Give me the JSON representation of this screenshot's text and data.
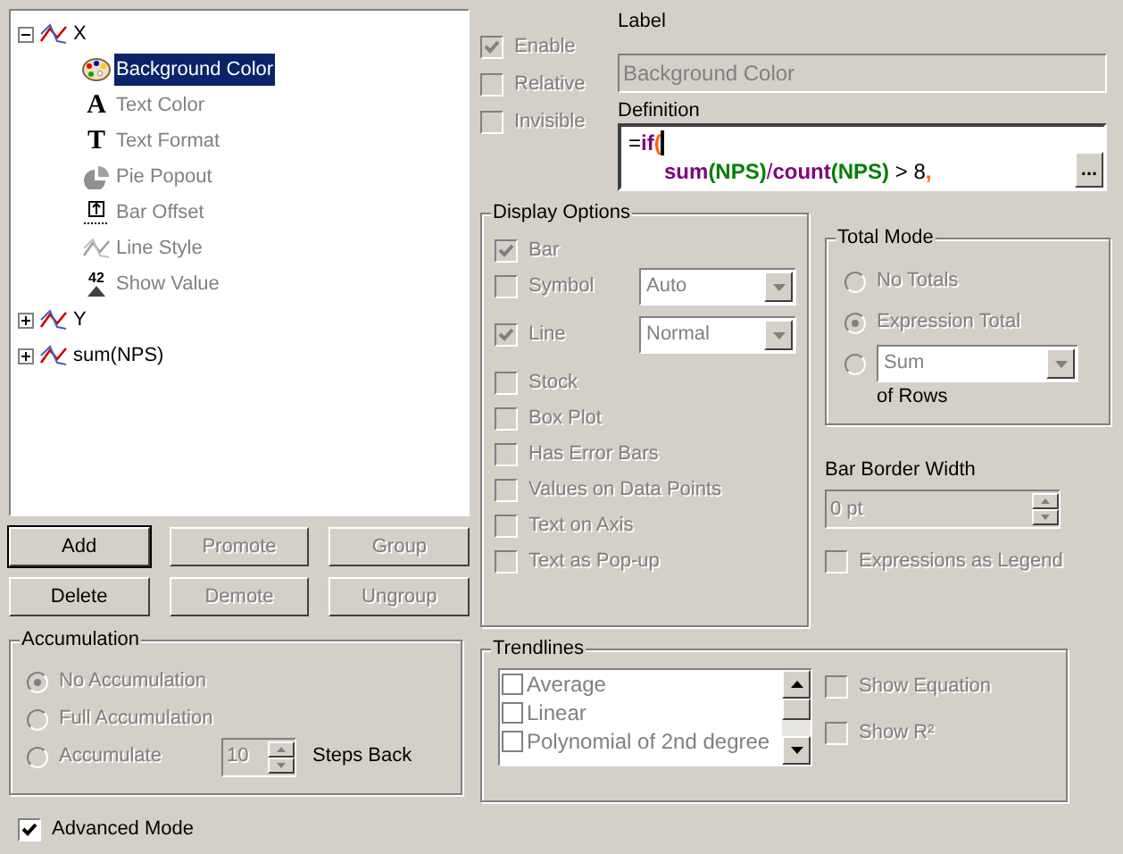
{
  "tree": {
    "items": [
      {
        "label": "X",
        "expanded": true,
        "children": [
          {
            "label": "Background Color",
            "kind": "palette",
            "defined": true,
            "selected": true
          },
          {
            "label": "Text Color",
            "kind": "glyph",
            "glyph": "A",
            "defined": false,
            "selected": false
          },
          {
            "label": "Text Format",
            "kind": "glyph",
            "glyph": "T",
            "defined": false,
            "selected": false
          },
          {
            "label": "Pie Popout",
            "kind": "pie",
            "defined": false,
            "selected": false
          },
          {
            "label": "Bar Offset",
            "kind": "offset",
            "defined": false,
            "selected": false
          },
          {
            "label": "Line Style",
            "kind": "line",
            "defined": false,
            "selected": false
          },
          {
            "label": "Show Value",
            "kind": "value",
            "glyph": "42",
            "defined": false,
            "selected": false
          }
        ]
      },
      {
        "label": "Y",
        "expanded": false
      },
      {
        "label": "sum(NPS)",
        "expanded": false
      }
    ]
  },
  "buttons": [
    {
      "label": "Add",
      "disabled": false,
      "default": true
    },
    {
      "label": "Promote",
      "disabled": true,
      "default": false
    },
    {
      "label": "Group",
      "disabled": true,
      "default": false
    },
    {
      "label": "Delete",
      "disabled": false,
      "default": false
    },
    {
      "label": "Demote",
      "disabled": true,
      "default": false
    },
    {
      "label": "Ungroup",
      "disabled": true,
      "default": false
    }
  ],
  "accumulation": {
    "title": "Accumulation",
    "disabled": true,
    "options": [
      {
        "label": "No Accumulation",
        "selected": true
      },
      {
        "label": "Full Accumulation",
        "selected": false
      },
      {
        "label": "Accumulate",
        "selected": false
      }
    ],
    "steps": "10",
    "steps_label": "Steps Back"
  },
  "advanced_mode": {
    "label": "Advanced Mode",
    "checked": true
  },
  "flags": [
    {
      "label": "Enable",
      "checked": true,
      "disabled": true
    },
    {
      "label": "Relative",
      "checked": false,
      "disabled": true
    },
    {
      "label": "Invisible",
      "checked": false,
      "disabled": true
    }
  ],
  "label_field": {
    "caption": "Label",
    "value": "Background Color",
    "disabled": true
  },
  "definition": {
    "caption": "Definition",
    "button": "...",
    "lines": [
      [
        {
          "kind": "plain",
          "text": "="
        },
        {
          "kind": "function",
          "text": "if"
        },
        {
          "kind": "delimiter",
          "text": "("
        }
      ],
      [
        {
          "kind": "function",
          "text": "sum"
        },
        {
          "kind": "field",
          "text": "(NPS)"
        },
        {
          "kind": "operator",
          "text": "/"
        },
        {
          "kind": "function",
          "text": "count"
        },
        {
          "kind": "field",
          "text": "(NPS)"
        },
        {
          "kind": "plain",
          "text": " > 8"
        },
        {
          "kind": "delimiter",
          "text": ","
        }
      ]
    ]
  },
  "display_options": {
    "title": "Display Options",
    "disabled": true,
    "options": [
      {
        "label": "Bar",
        "checked": true
      },
      {
        "label": "Symbol",
        "checked": false,
        "combo": "Auto"
      },
      {
        "label": "Line",
        "checked": true,
        "combo": "Normal"
      },
      {
        "label": "Stock",
        "checked": false
      },
      {
        "label": "Box Plot",
        "checked": false
      },
      {
        "label": "Has Error Bars",
        "checked": false
      },
      {
        "label": "Values on Data Points",
        "checked": false
      },
      {
        "label": "Text on Axis",
        "checked": false
      },
      {
        "label": "Text as Pop-up",
        "checked": false
      }
    ]
  },
  "total_mode": {
    "title": "Total Mode",
    "disabled": true,
    "options": [
      {
        "label": "No Totals",
        "selected": false
      },
      {
        "label": "Expression Total",
        "selected": true
      },
      {
        "combo": "Sum",
        "selected": false
      }
    ],
    "suffix": "of Rows"
  },
  "bar_border_width": {
    "caption": "Bar Border Width",
    "value": "0 pt",
    "disabled": true
  },
  "expressions_as_legend": {
    "label": "Expressions as Legend",
    "checked": false,
    "disabled": true
  },
  "trendlines": {
    "title": "Trendlines",
    "disabled": true,
    "items": [
      {
        "label": "Average",
        "checked": false
      },
      {
        "label": "Linear",
        "checked": false
      },
      {
        "label": "Polynomial of 2nd degree",
        "checked": false
      }
    ],
    "options": [
      {
        "label": "Show Equation",
        "checked": false
      },
      {
        "label": "Show R²",
        "checked": false
      }
    ]
  }
}
